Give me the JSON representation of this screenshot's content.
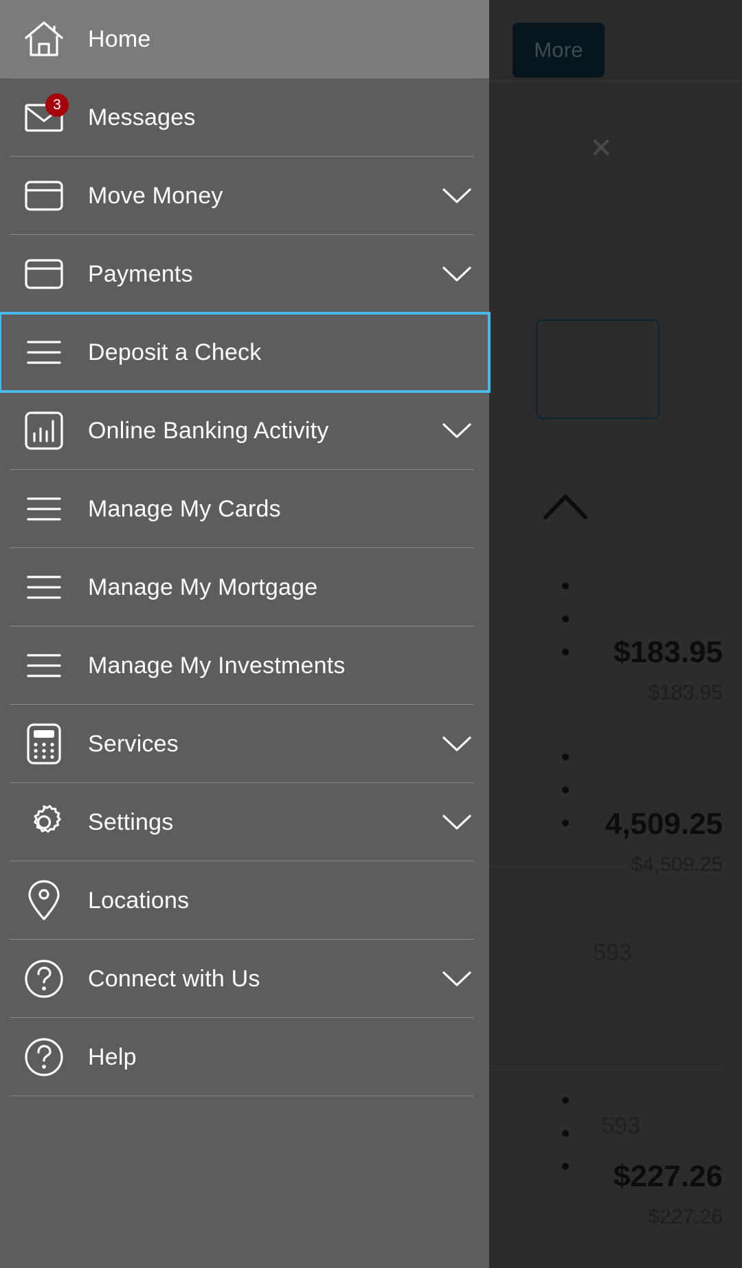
{
  "app": {
    "background_color": "#2c2c2c",
    "drawer_color": "#5d5d5d",
    "focus_color": "#4ab8e8",
    "badge_color": "#a8000b"
  },
  "background": {
    "more_button_label": "More",
    "close_icon": "close-icon",
    "collapse_icon": "chevron-up-icon",
    "accounts": [
      {
        "account_number": "",
        "available_balance": "$183.95",
        "current_balance": "$183.95",
        "menu_icon": "kebab-menu-icon"
      },
      {
        "account_number": "",
        "available_balance": "4,509.25",
        "current_balance": "$4,509.25",
        "menu_icon": "kebab-menu-icon"
      },
      {
        "account_number": "593",
        "available_balance": "$227.26",
        "current_balance": "$227.26",
        "menu_icon": "kebab-menu-icon"
      }
    ]
  },
  "drawer": {
    "items": [
      {
        "label": "Home",
        "icon": "home-icon",
        "expandable": false,
        "active": true,
        "focused": false,
        "badge": null
      },
      {
        "label": "Messages",
        "icon": "envelope-icon",
        "expandable": false,
        "active": false,
        "focused": false,
        "badge": "3"
      },
      {
        "label": "Move Money",
        "icon": "card-icon",
        "expandable": true,
        "active": false,
        "focused": false,
        "badge": null
      },
      {
        "label": "Payments",
        "icon": "card-icon",
        "expandable": true,
        "active": false,
        "focused": false,
        "badge": null
      },
      {
        "label": "Deposit a Check",
        "icon": "hamburger-icon",
        "expandable": false,
        "active": false,
        "focused": true,
        "badge": null
      },
      {
        "label": "Online Banking Activity",
        "icon": "bar-chart-icon",
        "expandable": true,
        "active": false,
        "focused": false,
        "badge": null
      },
      {
        "label": "Manage My Cards",
        "icon": "hamburger-icon",
        "expandable": false,
        "active": false,
        "focused": false,
        "badge": null
      },
      {
        "label": "Manage My Mortgage",
        "icon": "hamburger-icon",
        "expandable": false,
        "active": false,
        "focused": false,
        "badge": null
      },
      {
        "label": "Manage My Investments",
        "icon": "hamburger-icon",
        "expandable": false,
        "active": false,
        "focused": false,
        "badge": null
      },
      {
        "label": "Services",
        "icon": "calculator-icon",
        "expandable": true,
        "active": false,
        "focused": false,
        "badge": null
      },
      {
        "label": "Settings",
        "icon": "gear-icon",
        "expandable": true,
        "active": false,
        "focused": false,
        "badge": null
      },
      {
        "label": "Locations",
        "icon": "map-pin-icon",
        "expandable": false,
        "active": false,
        "focused": false,
        "badge": null
      },
      {
        "label": "Connect with Us",
        "icon": "question-circle-icon",
        "expandable": true,
        "active": false,
        "focused": false,
        "badge": null
      },
      {
        "label": "Help",
        "icon": "question-circle-icon",
        "expandable": false,
        "active": false,
        "focused": false,
        "badge": null
      }
    ]
  }
}
